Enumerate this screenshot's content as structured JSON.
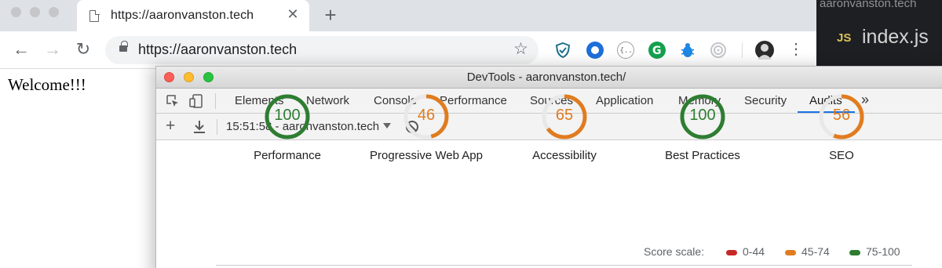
{
  "browser": {
    "tab_title": "https://aaronvanston.tech",
    "url": "https://aaronvanston.tech",
    "close_glyph": "✕",
    "new_tab_glyph": "+",
    "back_glyph": "←",
    "forward_glyph": "→",
    "reload_glyph": "↻",
    "star_glyph": "☆",
    "menu_glyph": "⋮"
  },
  "editor": {
    "breadcrumb": "aaronvanston.tech",
    "lang_badge": "JS",
    "file_name": "index.js"
  },
  "page": {
    "welcome_text": "Welcome!!!"
  },
  "devtools": {
    "window_title": "DevTools - aaronvanston.tech/",
    "tabs": [
      "Elements",
      "Network",
      "Console",
      "Performance",
      "Sources",
      "Application",
      "Memory",
      "Security",
      "Audits"
    ],
    "active_tab": "Audits",
    "overflow_glyph": "»",
    "toolbar": {
      "add_glyph": "+",
      "report_label": "15:51:58 - aaronvanston.tech"
    },
    "audits": [
      {
        "label": "Performance",
        "score": 100,
        "color": "#2e7d32"
      },
      {
        "label": "Progressive Web App",
        "score": 46,
        "color": "#e07c1f"
      },
      {
        "label": "Accessibility",
        "score": 65,
        "color": "#e07c1f"
      },
      {
        "label": "Best Practices",
        "score": 100,
        "color": "#2e7d32"
      },
      {
        "label": "SEO",
        "score": 56,
        "color": "#e07c1f"
      }
    ],
    "score_scale": {
      "title": "Score scale:",
      "ranges": [
        {
          "label": "0-44",
          "color": "#c62828"
        },
        {
          "label": "45-74",
          "color": "#e07c1f"
        },
        {
          "label": "75-100",
          "color": "#2e7d32"
        }
      ]
    }
  }
}
